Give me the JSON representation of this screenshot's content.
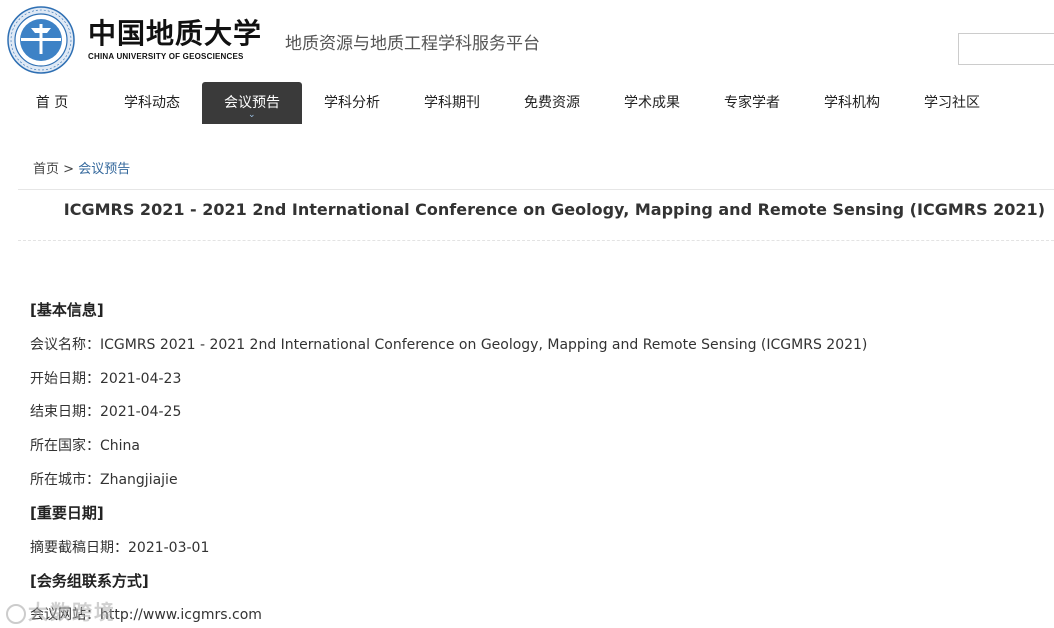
{
  "header": {
    "logo_cn": "中国地质大学",
    "logo_en": "CHINA UNIVERSITY OF GEOSCIENCES",
    "platform_title": "地质资源与地质工程学科服务平台",
    "search": {
      "value": "",
      "placeholder": ""
    }
  },
  "nav": {
    "items": [
      {
        "label": "首 页"
      },
      {
        "label": "学科动态"
      },
      {
        "label": "会议预告"
      },
      {
        "label": "学科分析"
      },
      {
        "label": "学科期刊"
      },
      {
        "label": "免费资源"
      },
      {
        "label": "学术成果"
      },
      {
        "label": "专家学者"
      },
      {
        "label": "学科机构"
      },
      {
        "label": "学习社区"
      }
    ],
    "active_index": 2
  },
  "breadcrumb": {
    "home": "首页",
    "sep": ">",
    "current": "会议预告"
  },
  "conference": {
    "title": "ICGMRS 2021 - 2021 2nd International Conference on Geology, Mapping and Remote Sensing (ICGMRS 2021)",
    "basic_info": {
      "heading": "[基本信息]",
      "rows": [
        {
          "label": "会议名称：",
          "value": "ICGMRS 2021 - 2021 2nd International Conference on Geology, Mapping and Remote Sensing (ICGMRS 2021)"
        },
        {
          "label": "开始日期：",
          "value": "2021-04-23"
        },
        {
          "label": "结束日期：",
          "value": "2021-04-25"
        },
        {
          "label": "所在国家：",
          "value": "China"
        },
        {
          "label": "所在城市：",
          "value": "Zhangjiajie"
        }
      ]
    },
    "important_dates": {
      "heading": "[重要日期]",
      "rows": [
        {
          "label": "摘要截稿日期：",
          "value": "2021-03-01"
        }
      ]
    },
    "contact": {
      "heading": "[会务组联系方式]",
      "rows": [
        {
          "label": "会议网站：",
          "value": "http://www.icgmrs.com"
        }
      ]
    }
  },
  "watermark": {
    "text": "大数跨境"
  },
  "colors": {
    "nav_active_bg": "#3a3a3a",
    "breadcrumb_current": "#34689c",
    "logo_blue": "#2e6fb3"
  }
}
